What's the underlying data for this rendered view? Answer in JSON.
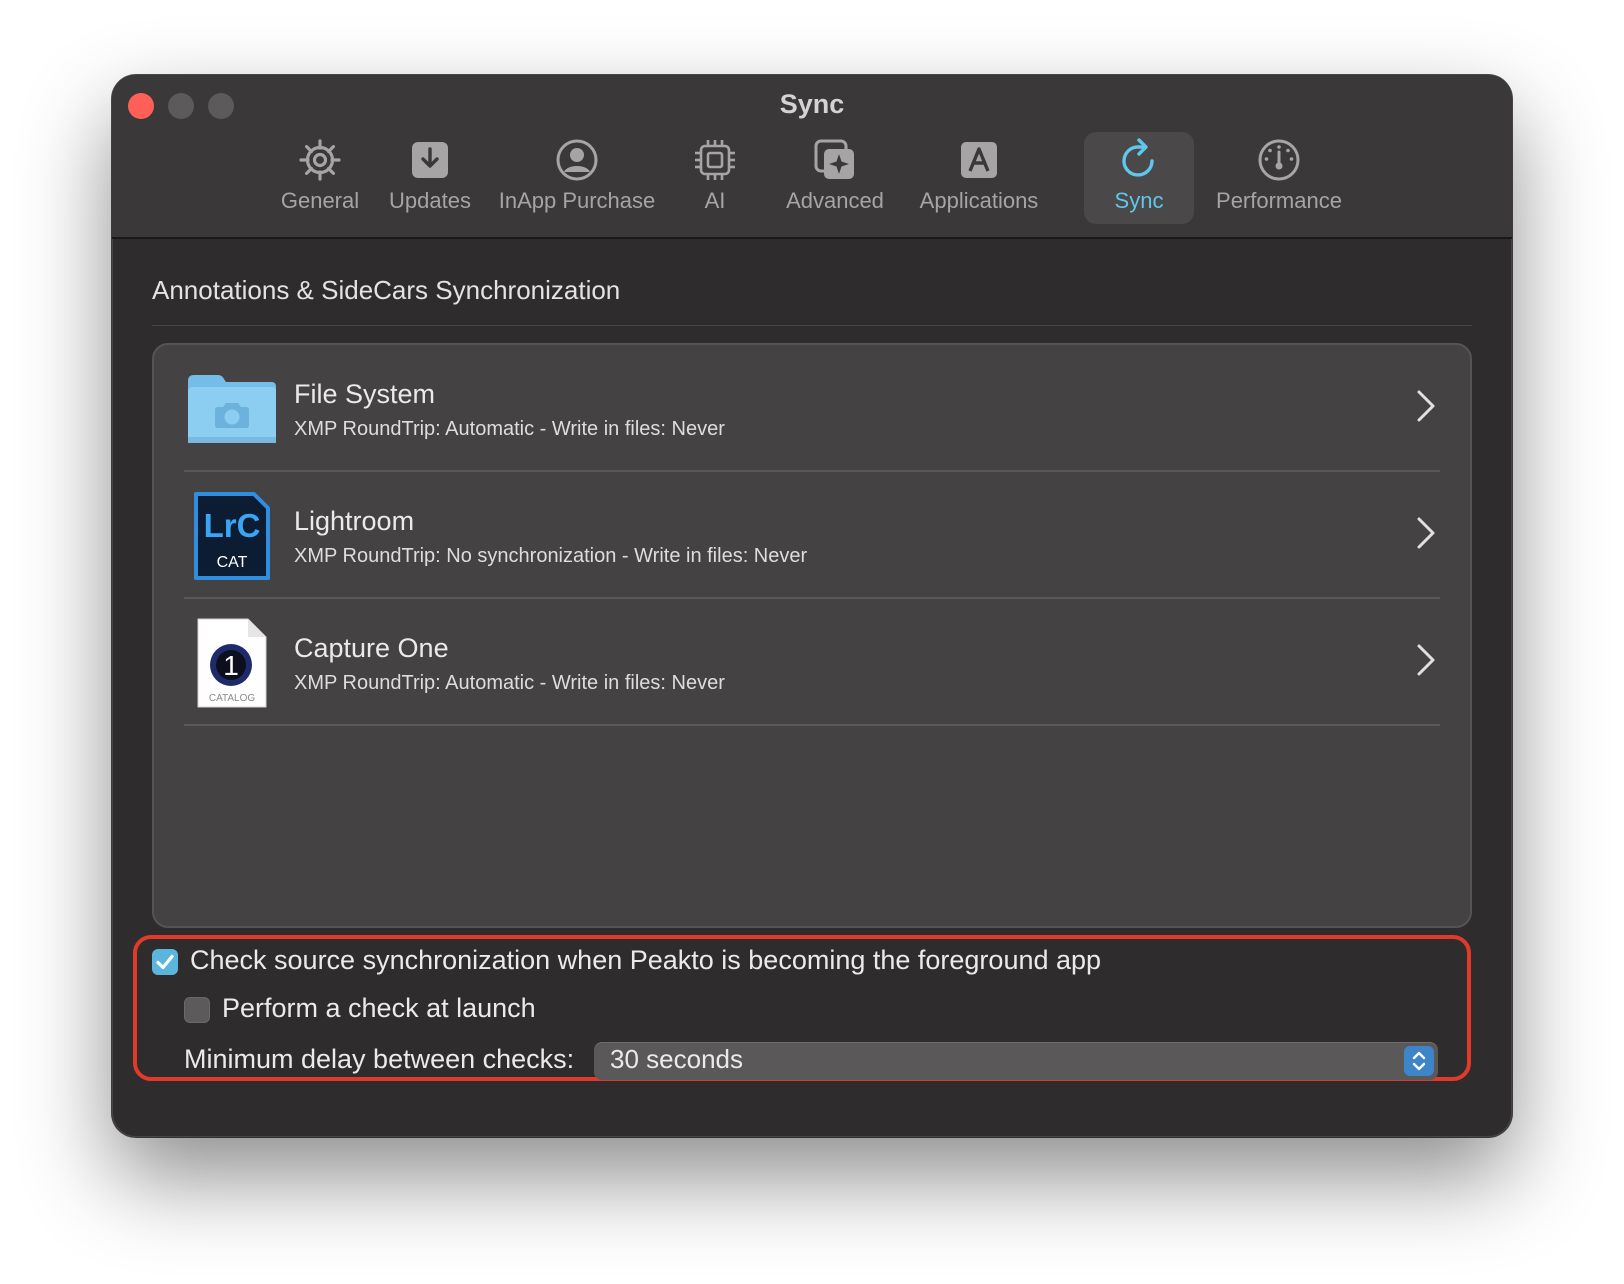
{
  "window": {
    "title": "Sync",
    "colors": {
      "accent": "#5fc6ec",
      "close": "#fe5f57",
      "highlight_border": "#e23a2a",
      "checkbox": "#5bb5dc"
    }
  },
  "tabs": [
    {
      "label": "General",
      "icon": "gear-icon"
    },
    {
      "label": "Updates",
      "icon": "download-arrow-icon"
    },
    {
      "label": "InApp Purchase",
      "icon": "person-circle-icon"
    },
    {
      "label": "AI",
      "icon": "cpu-chip-icon"
    },
    {
      "label": "Advanced",
      "icon": "sparkle-square-icon"
    },
    {
      "label": "Applications",
      "icon": "a-square-icon"
    },
    {
      "label": "Sync",
      "icon": "sync-arrow-icon",
      "selected": true
    },
    {
      "label": "Performance",
      "icon": "speedometer-icon"
    }
  ],
  "section": {
    "title": "Annotations & SideCars Synchronization"
  },
  "sources": [
    {
      "name": "File System",
      "description": "XMP RoundTrip: Automatic - Write in files: Never",
      "icon": "folder-camera-icon"
    },
    {
      "name": "Lightroom",
      "description": "XMP RoundTrip: No synchronization - Write in files: Never",
      "icon": "lrc-cat-icon",
      "icon_text": "LrC",
      "icon_subtext": "CAT"
    },
    {
      "name": "Capture One",
      "description": "XMP RoundTrip: Automatic - Write in files: Never",
      "icon": "capture-one-catalog-icon",
      "icon_subtext": "CATALOG"
    }
  ],
  "options": {
    "check_foreground": {
      "label": "Check source synchronization when Peakto is becoming the foreground app",
      "checked": true
    },
    "check_launch": {
      "label": "Perform a check at launch",
      "checked": false
    },
    "min_delay": {
      "label": "Minimum delay between checks:",
      "value": "30 seconds"
    }
  }
}
